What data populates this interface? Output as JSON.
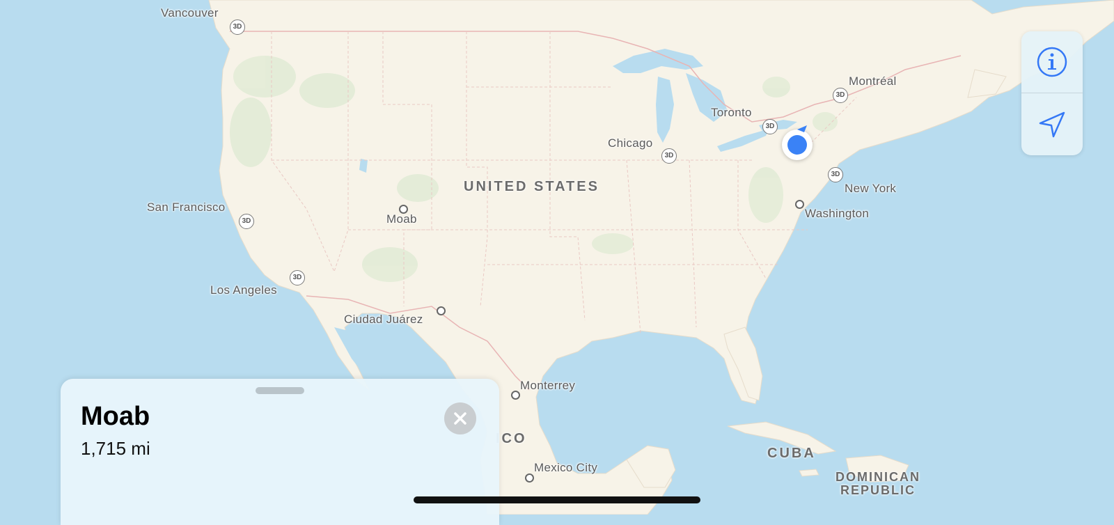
{
  "map": {
    "cities": [
      {
        "id": "vancouver",
        "name": "Vancouver"
      },
      {
        "id": "san-francisco",
        "name": "San Francisco"
      },
      {
        "id": "los-angeles",
        "name": "Los Angeles"
      },
      {
        "id": "moab",
        "name": "Moab"
      },
      {
        "id": "ciudad-juarez",
        "name": "Ciudad Juárez"
      },
      {
        "id": "chicago",
        "name": "Chicago"
      },
      {
        "id": "toronto",
        "name": "Toronto"
      },
      {
        "id": "montreal",
        "name": "Montréal"
      },
      {
        "id": "new-york",
        "name": "New York"
      },
      {
        "id": "washington",
        "name": "Washington"
      },
      {
        "id": "monterrey",
        "name": "Monterrey"
      },
      {
        "id": "mexico-city",
        "name": "Mexico City"
      }
    ],
    "countries": {
      "united_states": "UNITED STATES",
      "mexico_partial": "ICO",
      "cuba": "CUBA",
      "dominican_republic_line1": "DOMINICAN",
      "dominican_republic_line2": "REPUBLIC"
    },
    "badge_3d": "3D",
    "colors": {
      "water": "#b8dcef",
      "land": "#f7f3e8",
      "user_location": "#3a82f6",
      "border": "#e8b4b4"
    }
  },
  "controls": {
    "info_icon": "info-icon",
    "location_icon": "location-arrow-icon",
    "accent": "#3478f6"
  },
  "place_card": {
    "title": "Moab",
    "distance": "1,715 mi",
    "close_icon": "close-icon"
  }
}
